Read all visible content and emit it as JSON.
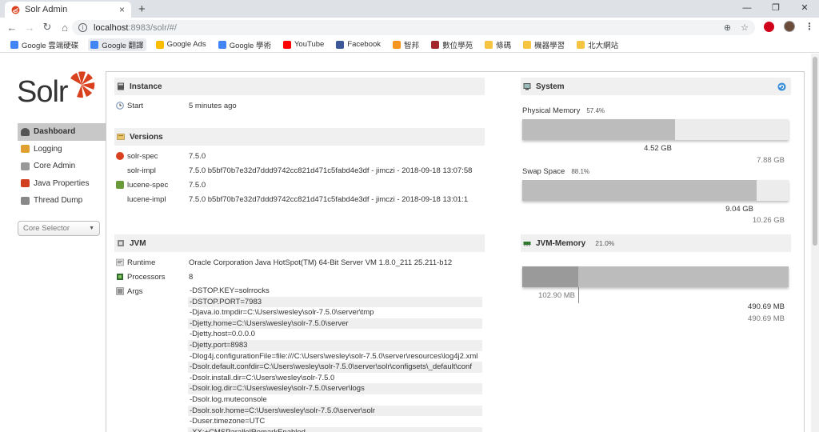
{
  "browser": {
    "tab_title": "Solr Admin",
    "new_tab": "+",
    "url_host": "localhost",
    "url_path": ":8983/solr/#/",
    "bookmarks": [
      {
        "label": "Google 雲端硬碟",
        "color": "#4285f4"
      },
      {
        "label": "Google 翻譯",
        "color": "#4285f4"
      },
      {
        "label": "Google Ads",
        "color": "#fbbc04"
      },
      {
        "label": "Google 學術",
        "color": "#4285f4"
      },
      {
        "label": "YouTube",
        "color": "#ff0000"
      },
      {
        "label": "Facebook",
        "color": "#3b5998"
      },
      {
        "label": "智邦",
        "color": "#f7941d"
      },
      {
        "label": "數位學苑",
        "color": "#a3262a"
      },
      {
        "label": "條碼",
        "color": "#f5c542"
      },
      {
        "label": "機器學習",
        "color": "#f5c542"
      },
      {
        "label": "北大網站",
        "color": "#f5c542"
      }
    ]
  },
  "logo": {
    "text": "Solr"
  },
  "nav": {
    "items": [
      {
        "label": "Dashboard",
        "active": true,
        "icon": "dashboard-icon"
      },
      {
        "label": "Logging",
        "icon": "logging-icon"
      },
      {
        "label": "Core Admin",
        "icon": "core-admin-icon"
      },
      {
        "label": "Java Properties",
        "icon": "java-icon"
      },
      {
        "label": "Thread Dump",
        "icon": "thread-icon"
      }
    ],
    "core_selector": "Core Selector"
  },
  "instance": {
    "title": "Instance",
    "start_label": "Start",
    "start_value": "5 minutes ago"
  },
  "versions": {
    "title": "Versions",
    "rows": [
      {
        "key": "solr-spec",
        "value": "7.5.0"
      },
      {
        "key": "solr-impl",
        "value": "7.5.0 b5bf70b7e32d7ddd9742cc821d471c5fabd4e3df - jimczi - 2018-09-18 13:07:58"
      },
      {
        "key": "lucene-spec",
        "value": "7.5.0"
      },
      {
        "key": "lucene-impl",
        "value": "7.5.0 b5bf70b7e32d7ddd9742cc821d471c5fabd4e3df - jimczi - 2018-09-18 13:01:1"
      }
    ]
  },
  "jvm": {
    "title": "JVM",
    "runtime_label": "Runtime",
    "runtime_value": "Oracle Corporation Java HotSpot(TM) 64-Bit Server VM 1.8.0_211 25.211-b12",
    "processors_label": "Processors",
    "processors_value": "8",
    "args_label": "Args",
    "args": [
      "-DSTOP.KEY=solrrocks",
      "-DSTOP.PORT=7983",
      "-Djava.io.tmpdir=C:\\Users\\wesley\\solr-7.5.0\\server\\tmp",
      "-Djetty.home=C:\\Users\\wesley\\solr-7.5.0\\server",
      "-Djetty.host=0.0.0.0",
      "-Djetty.port=8983",
      "-Dlog4j.configurationFile=file:///C:\\Users\\wesley\\solr-7.5.0\\server\\resources\\log4j2.xml",
      "-Dsolr.default.confdir=C:\\Users\\wesley\\solr-7.5.0\\server\\solr\\configsets\\_default\\conf",
      "-Dsolr.install.dir=C:\\Users\\wesley\\solr-7.5.0",
      "-Dsolr.log.dir=C:\\Users\\wesley\\solr-7.5.0\\server\\logs",
      "-Dsolr.log.muteconsole",
      "-Dsolr.solr.home=C:\\Users\\wesley\\solr-7.5.0\\server\\solr",
      "-Duser.timezone=UTC",
      "-XX:+CMSParallelRemarkEnabled"
    ]
  },
  "system": {
    "title": "System",
    "physical": {
      "label": "Physical Memory",
      "pct": "57.4%",
      "used": "4.52 GB",
      "total": "7.88 GB",
      "fraction": 0.574
    },
    "swap": {
      "label": "Swap Space",
      "pct": "88.1%",
      "used": "9.04 GB",
      "total": "10.26 GB",
      "fraction": 0.881
    }
  },
  "jvm_memory": {
    "title": "JVM-Memory",
    "pct": "21.0%",
    "used": "102.90 MB",
    "committed": "490.69 MB",
    "max": "490.69 MB",
    "used_fraction": 0.21,
    "committed_fraction": 1.0
  }
}
